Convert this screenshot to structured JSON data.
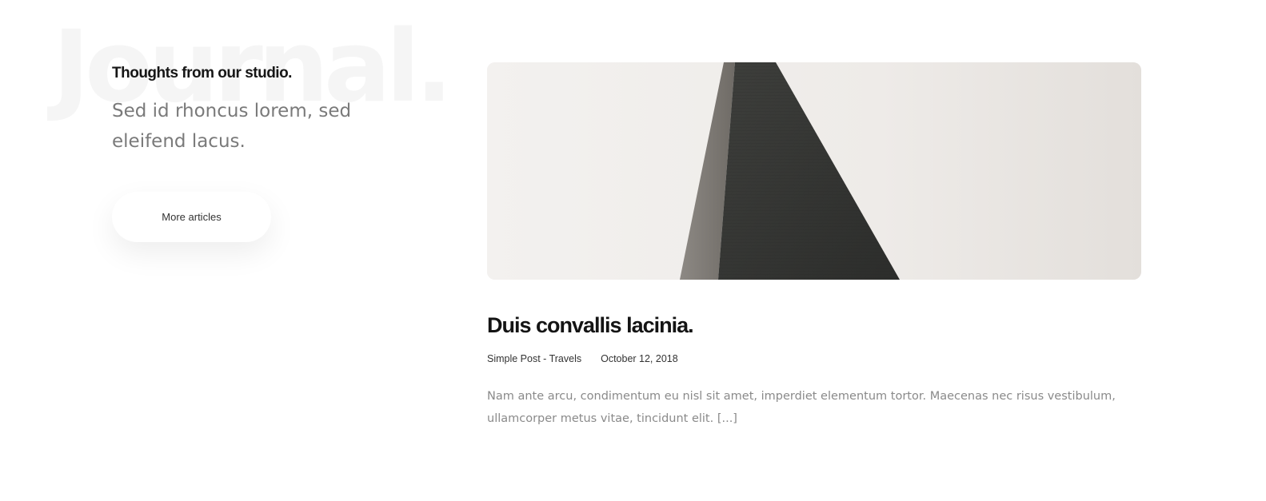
{
  "background_word": "Journal.",
  "intro": {
    "eyebrow": "Thoughts from our studio.",
    "lead": "Sed id rhoncus lorem, sed eleifend lacus.",
    "button_label": "More articles"
  },
  "post": {
    "title": "Duis convallis lacinia.",
    "category": "Simple Post - Travels",
    "date": "October 12, 2018",
    "excerpt": "Nam ante arcu, condimentum eu nisl sit amet, imperdiet elementum tortor. Maecenas nec risus vestibulum, ullamcorper metus vitae, tincidunt elit. [...]"
  },
  "colors": {
    "background": "#ffffff",
    "heading": "#141414",
    "body_text": "#8a8a8a",
    "watermark": "#f5f5f5"
  }
}
